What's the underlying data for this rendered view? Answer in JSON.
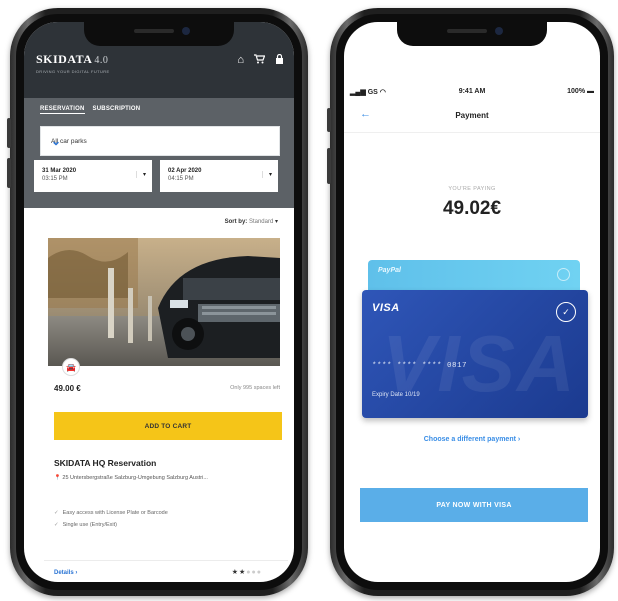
{
  "left_app": {
    "brand": {
      "logo": "SKIDATA",
      "logo_suffix": "4.0",
      "tagline": "DRIVING YOUR DIGITAL FUTURE"
    },
    "header_icons": [
      "home-icon",
      "cart-icon",
      "account-icon"
    ],
    "tabs": [
      {
        "label": "RESERVATION",
        "active": true
      },
      {
        "label": "SUBSCRIPTION",
        "active": false
      }
    ],
    "car_park_select": {
      "value": "All car parks"
    },
    "start_date": {
      "date": "31 Mar 2020",
      "time": "03:15 PM"
    },
    "end_date": {
      "date": "02 Apr 2020",
      "time": "04:15 PM"
    },
    "sort": {
      "label": "Sort by:",
      "value": "Standard"
    },
    "listing": {
      "price": "49.00 €",
      "availability": "Only 995 spaces left",
      "add_to_cart_label": "ADD TO CART",
      "title": "SKIDATA HQ Reservation",
      "address": "25 Untersbergstraße Salzburg-Umgebung Salzburg Austri...",
      "features": [
        "Easy access with License Plate or Barcode",
        "Single use (Entry/Exit)"
      ],
      "details_label": "Details",
      "rating": 2,
      "rating_max": 5
    }
  },
  "right_app": {
    "status_bar": {
      "carrier": "GS",
      "time": "9:41 AM",
      "battery": "100%"
    },
    "title": "Payment",
    "paying_label": "YOU'RE PAYING",
    "amount": "49.02€",
    "paypal_label": "PayPal",
    "visa": {
      "brand": "VISA",
      "number": "**** **** **** 0817",
      "expiry": "Expiry Date 10/19",
      "selected": true
    },
    "choose_label": "Choose a different payment",
    "pay_button_label": "PAY NOW WITH VISA"
  },
  "colors": {
    "header_dark": "#2e3338",
    "filter_gray": "#5c6166",
    "cart_yellow": "#f5c518",
    "link_blue": "#2a74d4",
    "visa_blue": "#1b3a8f",
    "paypal_cyan": "#5fc0ea",
    "pay_button": "#5aaee8"
  }
}
